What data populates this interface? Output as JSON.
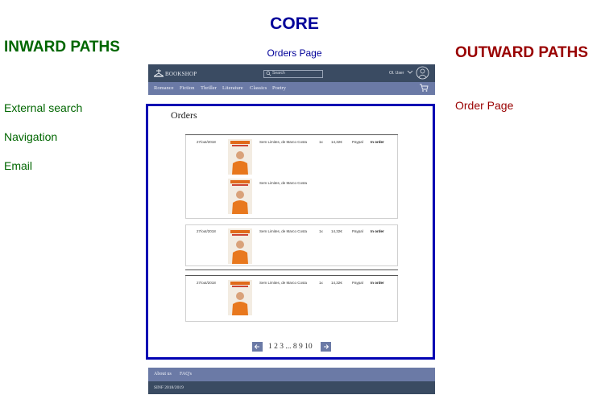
{
  "core": {
    "title": "CORE",
    "subtitle": "Orders Page"
  },
  "inward": {
    "title": "INWARD PATHS",
    "items": [
      "External search",
      "Navigation",
      "Email"
    ]
  },
  "outward": {
    "title": "OUTWARD PATHS",
    "items": [
      "Order Page"
    ]
  },
  "mockup": {
    "logo": "BOOKSHOP",
    "search_placeholder": "Search",
    "user": "Ol. User",
    "nav": [
      "Romance",
      "Fiction",
      "Thriller",
      "Literature",
      "Classics",
      "Poetry"
    ],
    "orders_heading": "Orders",
    "orders": [
      {
        "date": "27/out/2018",
        "title": "Sem Limites, de Marco Costa",
        "qty": "1x",
        "price": "14,32€",
        "payment": "Paypal",
        "status": "In order",
        "extra_item": "Sem Limites, de Marco Costa"
      },
      {
        "date": "27/out/2018",
        "title": "Sem Limites, de Marco Costa",
        "qty": "1x",
        "price": "14,32€",
        "payment": "Paypal",
        "status": "In order"
      },
      {
        "date": "27/out/2018",
        "title": "Sem Limites, de Marco Costa",
        "qty": "1x",
        "price": "14,32€",
        "payment": "Paypal",
        "status": "In order"
      }
    ],
    "pagination": "1 2 3 ... 8 9 10",
    "footer_links": [
      "About us",
      "FAQ's"
    ],
    "copyright": "SINF 2018/2019"
  },
  "colors": {
    "core": "#000099",
    "inward": "#006600",
    "outward": "#990000",
    "header": "#3a4b62",
    "nav": "#6b7aa6",
    "frame": "#0000b3"
  }
}
